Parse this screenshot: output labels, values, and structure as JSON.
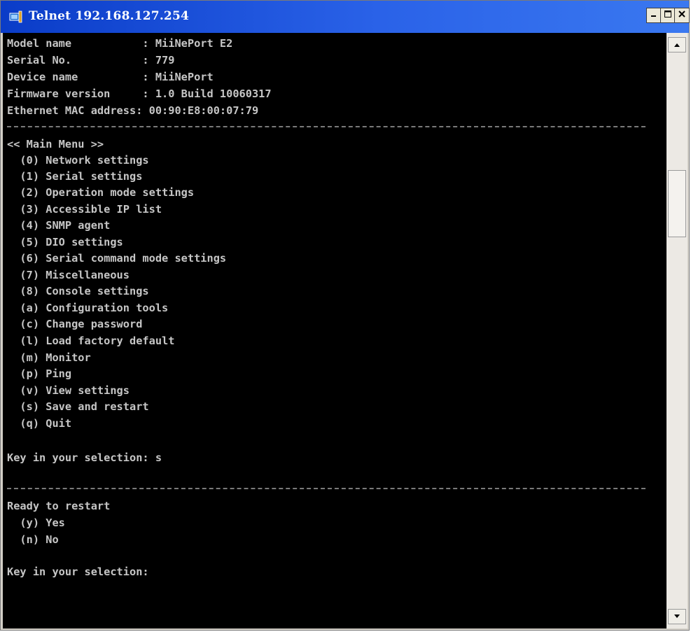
{
  "window": {
    "title": "Telnet 192.168.127.254"
  },
  "terminal": {
    "info": [
      "Model name           : MiiNePort E2",
      "Serial No.           : 779",
      "Device name          : MiiNePort",
      "Firmware version     : 1.0 Build 10060317",
      "Ethernet MAC address: 00:90:E8:00:07:79"
    ],
    "menu_title": "<< Main Menu >>",
    "menu_items": [
      "  (0) Network settings",
      "  (1) Serial settings",
      "  (2) Operation mode settings",
      "  (3) Accessible IP list",
      "  (4) SNMP agent",
      "  (5) DIO settings",
      "  (6) Serial command mode settings",
      "  (7) Miscellaneous",
      "  (8) Console settings",
      "  (a) Configuration tools",
      "  (c) Change password",
      "  (l) Load factory default",
      "  (m) Monitor",
      "  (p) Ping",
      "  (v) View settings",
      "  (s) Save and restart",
      "  (q) Quit"
    ],
    "prompt_1": "Key in your selection: s",
    "restart_title": "Ready to restart",
    "restart_options": [
      "  (y) Yes",
      "  (n) No"
    ],
    "prompt_2": "Key in your selection:"
  },
  "colors": {
    "titlebar": "#2a62e8",
    "terminal_bg": "#000000",
    "terminal_text": "#c6c6c6"
  }
}
